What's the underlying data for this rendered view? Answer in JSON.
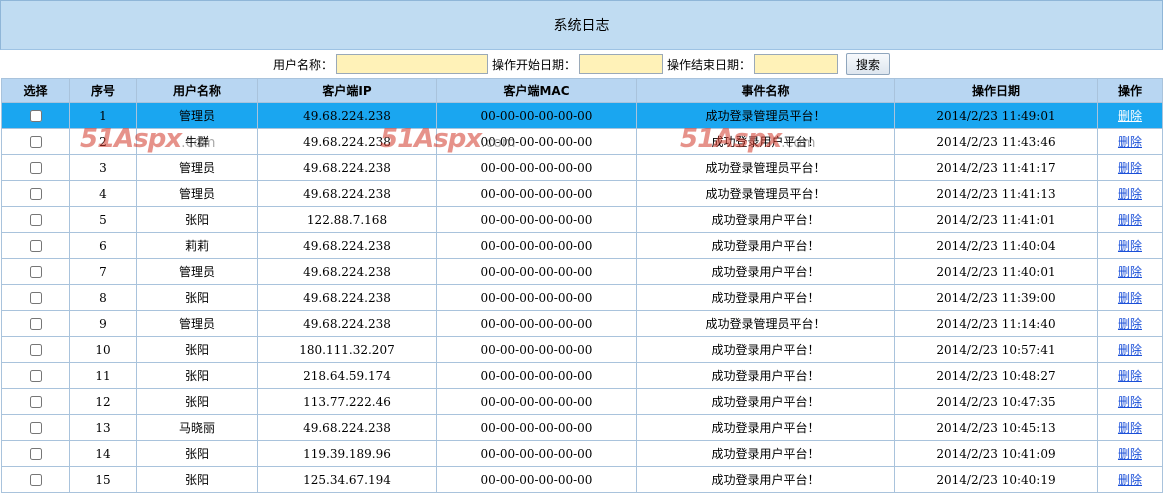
{
  "header": {
    "title": "系统日志"
  },
  "search": {
    "user_label": "用户名称：",
    "start_label": "操作开始日期：",
    "end_label": "操作结束日期：",
    "user_value": "",
    "start_value": "",
    "end_value": "",
    "button_label": "搜索"
  },
  "table": {
    "columns": [
      "选择",
      "序号",
      "用户名称",
      "客户端IP",
      "客户端MAC",
      "事件名称",
      "操作日期",
      "操作"
    ],
    "rows": [
      {
        "index": "1",
        "user": "管理员",
        "ip": "49.68.224.238",
        "mac": "00-00-00-00-00-00",
        "event": "成功登录管理员平台！",
        "date": "2014/2/23 11:49:01",
        "action": "删除",
        "selected": true
      },
      {
        "index": "2",
        "user": "牛群",
        "ip": "49.68.224.238",
        "mac": "00-00-00-00-00-00",
        "event": "成功登录用户平台！",
        "date": "2014/2/23 11:43:46",
        "action": "删除",
        "selected": false
      },
      {
        "index": "3",
        "user": "管理员",
        "ip": "49.68.224.238",
        "mac": "00-00-00-00-00-00",
        "event": "成功登录管理员平台！",
        "date": "2014/2/23 11:41:17",
        "action": "删除",
        "selected": false
      },
      {
        "index": "4",
        "user": "管理员",
        "ip": "49.68.224.238",
        "mac": "00-00-00-00-00-00",
        "event": "成功登录管理员平台！",
        "date": "2014/2/23 11:41:13",
        "action": "删除",
        "selected": false
      },
      {
        "index": "5",
        "user": "张阳",
        "ip": "122.88.7.168",
        "mac": "00-00-00-00-00-00",
        "event": "成功登录用户平台！",
        "date": "2014/2/23 11:41:01",
        "action": "删除",
        "selected": false
      },
      {
        "index": "6",
        "user": "莉莉",
        "ip": "49.68.224.238",
        "mac": "00-00-00-00-00-00",
        "event": "成功登录用户平台！",
        "date": "2014/2/23 11:40:04",
        "action": "删除",
        "selected": false
      },
      {
        "index": "7",
        "user": "管理员",
        "ip": "49.68.224.238",
        "mac": "00-00-00-00-00-00",
        "event": "成功登录用户平台！",
        "date": "2014/2/23 11:40:01",
        "action": "删除",
        "selected": false
      },
      {
        "index": "8",
        "user": "张阳",
        "ip": "49.68.224.238",
        "mac": "00-00-00-00-00-00",
        "event": "成功登录用户平台！",
        "date": "2014/2/23 11:39:00",
        "action": "删除",
        "selected": false
      },
      {
        "index": "9",
        "user": "管理员",
        "ip": "49.68.224.238",
        "mac": "00-00-00-00-00-00",
        "event": "成功登录管理员平台！",
        "date": "2014/2/23 11:14:40",
        "action": "删除",
        "selected": false
      },
      {
        "index": "10",
        "user": "张阳",
        "ip": "180.111.32.207",
        "mac": "00-00-00-00-00-00",
        "event": "成功登录用户平台！",
        "date": "2014/2/23 10:57:41",
        "action": "删除",
        "selected": false
      },
      {
        "index": "11",
        "user": "张阳",
        "ip": "218.64.59.174",
        "mac": "00-00-00-00-00-00",
        "event": "成功登录用户平台！",
        "date": "2014/2/23 10:48:27",
        "action": "删除",
        "selected": false
      },
      {
        "index": "12",
        "user": "张阳",
        "ip": "113.77.222.46",
        "mac": "00-00-00-00-00-00",
        "event": "成功登录用户平台！",
        "date": "2014/2/23 10:47:35",
        "action": "删除",
        "selected": false
      },
      {
        "index": "13",
        "user": "马晓丽",
        "ip": "49.68.224.238",
        "mac": "00-00-00-00-00-00",
        "event": "成功登录用户平台！",
        "date": "2014/2/23 10:45:13",
        "action": "删除",
        "selected": false
      },
      {
        "index": "14",
        "user": "张阳",
        "ip": "119.39.189.96",
        "mac": "00-00-00-00-00-00",
        "event": "成功登录用户平台！",
        "date": "2014/2/23 10:41:09",
        "action": "删除",
        "selected": false
      },
      {
        "index": "15",
        "user": "张阳",
        "ip": "125.34.67.194",
        "mac": "00-00-00-00-00-00",
        "event": "成功登录用户平台！",
        "date": "2014/2/23 10:40:19",
        "action": "删除",
        "selected": false
      }
    ]
  },
  "watermark": {
    "brand": "51Aspx",
    "suffix": ".com"
  },
  "colors": {
    "header_bg": "#c0dcf2",
    "grid_header_bg": "#b8d6f2",
    "selected_row": "#1aa6f0",
    "input_bg": "#fff2b8",
    "link": "#1a4fd8"
  }
}
